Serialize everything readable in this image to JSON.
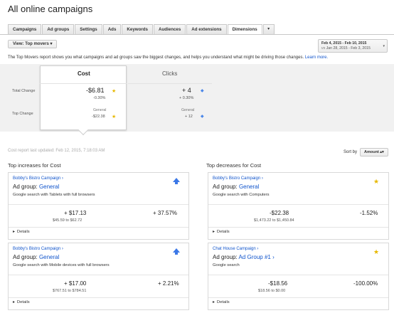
{
  "page_title": "All online campaigns",
  "tabs": [
    "Campaigns",
    "Ad groups",
    "Settings",
    "Ads",
    "Keywords",
    "Audiences",
    "Ad extensions",
    "Dimensions",
    "▾"
  ],
  "active_tab": "Dimensions",
  "view_button": "View: Top movers ▾",
  "date_range": {
    "primary": "Feb 4, 2015 - Feb 10, 2015",
    "vs_label": "vs",
    "secondary": "Jan 28, 2015 - Feb 3, 2015",
    "caret": "▾"
  },
  "info_text": "The Top Movers report shows you what campaigns and ad groups saw the biggest changes, and helps you understand what might be driving those changes.",
  "info_link": "Learn more.",
  "summary": {
    "col_cost": "Cost",
    "col_clicks": "Clicks",
    "row_total": "Total Change",
    "row_top": "Top Change",
    "cost_total": "-$6.81",
    "cost_total_pct": "-0.30%",
    "cost_top_label": "General",
    "cost_top_value": "-$22.38",
    "clicks_total": "+ 4",
    "clicks_total_pct": "+ 0.30%",
    "clicks_top_label": "General",
    "clicks_top_value": "+ 12"
  },
  "last_updated": "Cost report last updated: Feb 12, 2015, 7:18:03 AM",
  "sort": {
    "label": "Sort by",
    "value": "Amount ▴▾"
  },
  "increases_title": "Top increases for Cost",
  "decreases_title": "Top decreases for Cost",
  "adgroup_prefix": "Ad group:",
  "details_label": "Details",
  "cards": [
    {
      "campaign": "Bobby's Bistro Campaign ›",
      "adgroup": "General",
      "desc": "Google search with Tablets with full browsers",
      "value": "+ $17.13",
      "range": "$45.59 to $62.72",
      "pct": "+ 37.57%",
      "icon": "arrow-up-icon"
    },
    {
      "campaign": "Bobby's Bistro Campaign ›",
      "adgroup": "General",
      "desc": "Google search with Computers",
      "value": "-$22.38",
      "range": "$1,473.22 to $1,450.84",
      "pct": "-1.52%",
      "icon": "star-icon"
    },
    {
      "campaign": "Bobby's Bistro Campaign ›",
      "adgroup": "General",
      "desc": "Google search with Mobile devices with full browsers",
      "value": "+ $17.00",
      "range": "$767.51 to $784.51",
      "pct": "+ 2.21%",
      "icon": "arrow-up-icon"
    },
    {
      "campaign": "Chat House Campaign ›",
      "adgroup": "Ad Group #1 ›",
      "desc": "Google search",
      "value": "-$18.56",
      "range": "$18.56 to $0.00",
      "pct": "-100.00%",
      "icon": "star-icon"
    }
  ]
}
